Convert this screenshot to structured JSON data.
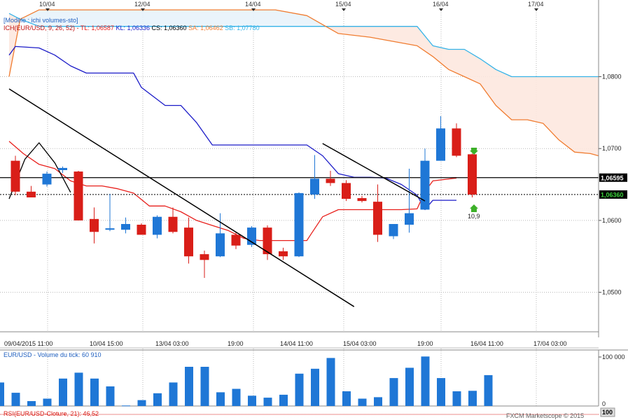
{
  "header": {
    "template_label": "[Modèle : ichi volumes-sto]",
    "ichi_name": "ICH(EUR/USD, 9, 26, 52)",
    "tl_label": "TL: 1,06587",
    "kl_label": "KL: 1,06336",
    "cs_label": "CS: 1,06360",
    "sa_label": "SA: 1,06462",
    "sb_label": "SB: 1,07780"
  },
  "volume_panel": {
    "label": "EUR/USD - Volume du tick: 60 910",
    "axis_ticks": [
      "100 000",
      "0"
    ]
  },
  "rsi_panel": {
    "label": "RSI(EUR/USD-Cloture, 21): 46,52",
    "axis_tick": "100"
  },
  "footer": {
    "watermark": "FXCM Marketscope © 2015"
  },
  "annotations": {
    "signal_value": "10,9"
  },
  "colors": {
    "bull": "#1f77d6",
    "bear": "#d91e18",
    "tenkan": "#e8201c",
    "kijun": "#1c1cc8",
    "senkou_a": "#f07c30",
    "senkou_b": "#35b3e8",
    "cloud_fill": "#fde8df",
    "cloud_fill_bull": "#e8f3fb",
    "trendline": "#000000",
    "grid": "#b9b9b9",
    "volume_bar": "#1f77d6",
    "signal_arrow": "#3cb028",
    "price_badge_bg": "#000000",
    "price_badge_fg": "#ffffff",
    "price_badge_fg_green": "#3cd23c"
  },
  "chart_data": {
    "type": "candlestick",
    "instrument": "EUR/USD",
    "y_axis": {
      "ticks": [
        "1,0800",
        "1,0700",
        "1,0600",
        "1,0500"
      ],
      "tick_values": [
        1.08,
        1.07,
        1.06,
        1.05
      ],
      "ylim": [
        1.0445,
        1.0895
      ]
    },
    "x_axis_bottom_labels": [
      "09/04/2015 11:00",
      "10/04 15:00",
      "13/04 03:00",
      "19:00",
      "14/04 11:00",
      "15/04 03:00",
      "19:00",
      "16/04 11:00",
      "17/04 03:00"
    ],
    "x_axis_top_labels": [
      "10/04",
      "12/04",
      "14/04",
      "15/04",
      "16/04",
      "17/04"
    ],
    "price_lines": [
      {
        "label": "1,06595",
        "value": 1.06595,
        "style": "solid"
      },
      {
        "label": "1,06360",
        "value": 1.0636,
        "style": "dotted"
      }
    ],
    "candles": [
      {
        "o": 1.0683,
        "h": 1.069,
        "l": 1.0635,
        "c": 1.064
      },
      {
        "o": 1.064,
        "h": 1.0648,
        "l": 1.0635,
        "c": 1.0632
      },
      {
        "o": 1.065,
        "h": 1.0668,
        "l": 1.0647,
        "c": 1.0665
      },
      {
        "o": 1.067,
        "h": 1.0675,
        "l": 1.0666,
        "c": 1.0673
      },
      {
        "o": 1.0668,
        "h": 1.0669,
        "l": 1.06,
        "c": 1.06
      },
      {
        "o": 1.0602,
        "h": 1.0618,
        "l": 1.0568,
        "c": 1.0584
      },
      {
        "o": 1.0587,
        "h": 1.0637,
        "l": 1.0585,
        "c": 1.0589
      },
      {
        "o": 1.0587,
        "h": 1.0604,
        "l": 1.0582,
        "c": 1.0595
      },
      {
        "o": 1.0594,
        "h": 1.0596,
        "l": 1.0583,
        "c": 1.058
      },
      {
        "o": 1.058,
        "h": 1.0607,
        "l": 1.0575,
        "c": 1.0605
      },
      {
        "o": 1.0605,
        "h": 1.0618,
        "l": 1.0582,
        "c": 1.0584
      },
      {
        "o": 1.059,
        "h": 1.0604,
        "l": 1.054,
        "c": 1.055
      },
      {
        "o": 1.0553,
        "h": 1.0558,
        "l": 1.052,
        "c": 1.0545
      },
      {
        "o": 1.055,
        "h": 1.061,
        "l": 1.0549,
        "c": 1.0582
      },
      {
        "o": 1.058,
        "h": 1.0583,
        "l": 1.056,
        "c": 1.0565
      },
      {
        "o": 1.0566,
        "h": 1.0592,
        "l": 1.0563,
        "c": 1.059
      },
      {
        "o": 1.059,
        "h": 1.0593,
        "l": 1.0545,
        "c": 1.0553
      },
      {
        "o": 1.0557,
        "h": 1.0562,
        "l": 1.0545,
        "c": 1.055
      },
      {
        "o": 1.055,
        "h": 1.0639,
        "l": 1.0549,
        "c": 1.0638
      },
      {
        "o": 1.0636,
        "h": 1.0691,
        "l": 1.063,
        "c": 1.0658
      },
      {
        "o": 1.0658,
        "h": 1.0669,
        "l": 1.0648,
        "c": 1.0652
      },
      {
        "o": 1.0652,
        "h": 1.0656,
        "l": 1.0627,
        "c": 1.063
      },
      {
        "o": 1.0631,
        "h": 1.0634,
        "l": 1.0625,
        "c": 1.0627
      },
      {
        "o": 1.0626,
        "h": 1.065,
        "l": 1.057,
        "c": 1.058
      },
      {
        "o": 1.0578,
        "h": 1.0595,
        "l": 1.0574,
        "c": 1.0595
      },
      {
        "o": 1.0594,
        "h": 1.0672,
        "l": 1.0583,
        "c": 1.061
      },
      {
        "o": 1.0615,
        "h": 1.07,
        "l": 1.0615,
        "c": 1.0683
      },
      {
        "o": 1.0683,
        "h": 1.0745,
        "l": 1.0683,
        "c": 1.0728
      },
      {
        "o": 1.0728,
        "h": 1.0735,
        "l": 1.0688,
        "c": 1.069
      },
      {
        "o": 1.0692,
        "h": 1.0693,
        "l": 1.0632,
        "c": 1.0636
      }
    ],
    "tenkan": [
      [
        -0.4,
        1.071
      ],
      [
        0.5,
        1.0693
      ],
      [
        1.5,
        1.0678
      ],
      [
        2.5,
        1.0672
      ],
      [
        3.5,
        1.0655
      ],
      [
        4.5,
        1.0648
      ],
      [
        5.5,
        1.0648
      ],
      [
        6.5,
        1.0644
      ],
      [
        7.5,
        1.0638
      ],
      [
        8.5,
        1.062
      ],
      [
        9.5,
        1.062
      ],
      [
        10.5,
        1.0612
      ],
      [
        11.5,
        1.06
      ],
      [
        12.5,
        1.0593
      ],
      [
        13.5,
        1.0586
      ],
      [
        14.5,
        1.0575
      ],
      [
        15.5,
        1.0572
      ],
      [
        16.5,
        1.0572
      ],
      [
        17.5,
        1.0572
      ],
      [
        18.5,
        1.0572
      ],
      [
        18.8,
        1.0582
      ],
      [
        19.5,
        1.0605
      ],
      [
        20.5,
        1.0615
      ],
      [
        21.5,
        1.0615
      ],
      [
        22.5,
        1.0615
      ],
      [
        23.5,
        1.0615
      ],
      [
        24.5,
        1.0615
      ],
      [
        25.5,
        1.0616
      ],
      [
        26.0,
        1.064
      ],
      [
        26.5,
        1.0655
      ],
      [
        28.0,
        1.0659
      ]
    ],
    "kijun": [
      [
        -0.4,
        1.083
      ],
      [
        0.0,
        1.0842
      ],
      [
        1.5,
        1.084
      ],
      [
        2.5,
        1.083
      ],
      [
        3.5,
        1.0815
      ],
      [
        4.5,
        1.0805
      ],
      [
        5.5,
        1.0805
      ],
      [
        7.5,
        1.0805
      ],
      [
        8.0,
        1.0785
      ],
      [
        9.5,
        1.076
      ],
      [
        10.5,
        1.076
      ],
      [
        11.5,
        1.0736
      ],
      [
        12.5,
        1.0705
      ],
      [
        13.5,
        1.0705
      ],
      [
        18.5,
        1.0705
      ],
      [
        19.5,
        1.069
      ],
      [
        20.5,
        1.0665
      ],
      [
        21.5,
        1.066
      ],
      [
        22.5,
        1.066
      ],
      [
        23.5,
        1.0659
      ],
      [
        24.5,
        1.065
      ],
      [
        25.5,
        1.0635
      ],
      [
        26.0,
        1.0615
      ],
      [
        26.5,
        1.0628
      ],
      [
        28.0,
        1.0628
      ]
    ],
    "senkou_a": [
      [
        -0.4,
        1.08
      ],
      [
        0.3,
        1.088
      ],
      [
        1.5,
        1.0893
      ],
      [
        16.5,
        1.0893
      ],
      [
        18.5,
        1.0885
      ],
      [
        20.5,
        1.086
      ],
      [
        22.5,
        1.0855
      ],
      [
        25.5,
        1.0843
      ],
      [
        26.5,
        1.0828
      ],
      [
        27.5,
        1.081
      ],
      [
        28.5,
        1.08
      ],
      [
        29.5,
        1.079
      ],
      [
        30.5,
        1.076
      ],
      [
        31.5,
        1.074
      ],
      [
        32.5,
        1.074
      ],
      [
        33.5,
        1.0735
      ],
      [
        34.5,
        1.0712
      ],
      [
        35.5,
        1.0695
      ],
      [
        36.5,
        1.0693
      ],
      [
        37.0,
        1.069
      ]
    ],
    "senkou_b": [
      [
        -0.4,
        1.0888
      ],
      [
        0.3,
        1.088
      ],
      [
        1.5,
        1.087
      ],
      [
        16.5,
        1.087
      ],
      [
        25.5,
        1.087
      ],
      [
        26.5,
        1.0843
      ],
      [
        27.5,
        1.0838
      ],
      [
        28.5,
        1.0838
      ],
      [
        29.5,
        1.0825
      ],
      [
        30.5,
        1.081
      ],
      [
        31.5,
        1.08
      ],
      [
        37.0,
        1.08
      ]
    ],
    "chikou": [
      [
        -0.4,
        1.063
      ],
      [
        0.6,
        1.0685
      ],
      [
        1.5,
        1.0708
      ],
      [
        2.5,
        1.068
      ],
      [
        3.5,
        1.0639
      ]
    ],
    "trendlines": [
      {
        "x1": -0.4,
        "y1": 1.0783,
        "x2": 21.5,
        "y2": 1.048
      },
      {
        "x1": 19.5,
        "y1": 1.0707,
        "x2": 26.0,
        "y2": 1.0627
      }
    ],
    "volume": {
      "values": [
        48000,
        27000,
        10000,
        15000,
        56000,
        68000,
        56000,
        40000,
        1000,
        12000,
        26000,
        48000,
        80000,
        80000,
        28000,
        35000,
        21000,
        17000,
        23000,
        66000,
        76000,
        98000,
        30000,
        15000,
        18000,
        57000,
        78000,
        101000,
        57000,
        30000,
        31000,
        63000
      ],
      "ylim": [
        0,
        110000
      ]
    }
  }
}
